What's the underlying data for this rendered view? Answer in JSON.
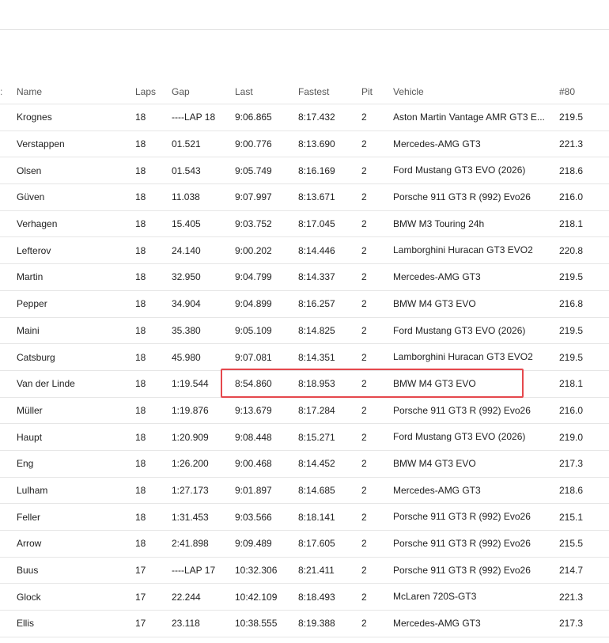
{
  "headers": {
    "edge": ":",
    "name": "Name",
    "laps": "Laps",
    "gap": "Gap",
    "last": "Last",
    "fastest": "Fastest",
    "pit": "Pit",
    "vehicle": "Vehicle",
    "top_speed": "#80"
  },
  "rows": [
    {
      "name": "Krognes",
      "laps": "18",
      "gap": "----LAP 18",
      "last": "9:06.865",
      "fastest": "8:17.432",
      "pit": "2",
      "vehicle": "Aston Martin Vantage AMR GT3 E...",
      "top_speed": "219.5"
    },
    {
      "name": "Verstappen",
      "laps": "18",
      "gap": "01.521",
      "last": "9:00.776",
      "fastest": "8:13.690",
      "pit": "2",
      "vehicle": "Mercedes-AMG GT3",
      "top_speed": "221.3"
    },
    {
      "name": "Olsen",
      "laps": "18",
      "gap": "01.543",
      "last": "9:05.749",
      "fastest": "8:16.169",
      "pit": "2",
      "vehicle": "Ford Mustang GT3 EVO (2026)",
      "top_speed": "218.6"
    },
    {
      "name": "Güven",
      "laps": "18",
      "gap": "11.038",
      "last": "9:07.997",
      "fastest": "8:13.671",
      "pit": "2",
      "vehicle": "Porsche 911 GT3 R (992) Evo26",
      "top_speed": "216.0"
    },
    {
      "name": "Verhagen",
      "laps": "18",
      "gap": "15.405",
      "last": "9:03.752",
      "fastest": "8:17.045",
      "pit": "2",
      "vehicle": "BMW M3 Touring 24h",
      "top_speed": "218.1"
    },
    {
      "name": "Lefterov",
      "laps": "18",
      "gap": "24.140",
      "last": "9:00.202",
      "fastest": "8:14.446",
      "pit": "2",
      "vehicle": "Lamborghini Huracan GT3 EVO2",
      "top_speed": "220.8"
    },
    {
      "name": "Martin",
      "laps": "18",
      "gap": "32.950",
      "last": "9:04.799",
      "fastest": "8:14.337",
      "pit": "2",
      "vehicle": "Mercedes-AMG GT3",
      "top_speed": "219.5"
    },
    {
      "name": "Pepper",
      "laps": "18",
      "gap": "34.904",
      "last": "9:04.899",
      "fastest": "8:16.257",
      "pit": "2",
      "vehicle": "BMW M4 GT3 EVO",
      "top_speed": "216.8"
    },
    {
      "name": "Maini",
      "laps": "18",
      "gap": "35.380",
      "last": "9:05.109",
      "fastest": "8:14.825",
      "pit": "2",
      "vehicle": "Ford Mustang GT3 EVO (2026)",
      "top_speed": "219.5"
    },
    {
      "name": "Catsburg",
      "laps": "18",
      "gap": "45.980",
      "last": "9:07.081",
      "fastest": "8:14.351",
      "pit": "2",
      "vehicle": "Lamborghini Huracan GT3 EVO2",
      "top_speed": "219.5"
    },
    {
      "name": "Van der Linde",
      "laps": "18",
      "gap": "1:19.544",
      "last": "8:54.860",
      "fastest": "8:18.953",
      "pit": "2",
      "vehicle": "BMW M4 GT3 EVO",
      "top_speed": "218.1"
    },
    {
      "name": "Müller",
      "laps": "18",
      "gap": "1:19.876",
      "last": "9:13.679",
      "fastest": "8:17.284",
      "pit": "2",
      "vehicle": "Porsche 911 GT3 R (992) Evo26",
      "top_speed": "216.0"
    },
    {
      "name": "Haupt",
      "laps": "18",
      "gap": "1:20.909",
      "last": "9:08.448",
      "fastest": "8:15.271",
      "pit": "2",
      "vehicle": "Ford Mustang GT3 EVO (2026)",
      "top_speed": "219.0"
    },
    {
      "name": "Eng",
      "laps": "18",
      "gap": "1:26.200",
      "last": "9:00.468",
      "fastest": "8:14.452",
      "pit": "2",
      "vehicle": "BMW M4 GT3 EVO",
      "top_speed": "217.3"
    },
    {
      "name": "Lulham",
      "laps": "18",
      "gap": "1:27.173",
      "last": "9:01.897",
      "fastest": "8:14.685",
      "pit": "2",
      "vehicle": "Mercedes-AMG GT3",
      "top_speed": "218.6"
    },
    {
      "name": "Feller",
      "laps": "18",
      "gap": "1:31.453",
      "last": "9:03.566",
      "fastest": "8:18.141",
      "pit": "2",
      "vehicle": "Porsche 911 GT3 R (992) Evo26",
      "top_speed": "215.1"
    },
    {
      "name": "Arrow",
      "laps": "18",
      "gap": "2:41.898",
      "last": "9:09.489",
      "fastest": "8:17.605",
      "pit": "2",
      "vehicle": "Porsche 911 GT3 R (992) Evo26",
      "top_speed": "215.5"
    },
    {
      "name": "Buus",
      "laps": "17",
      "gap": "----LAP 17",
      "last": "10:32.306",
      "fastest": "8:21.411",
      "pit": "2",
      "vehicle": "Porsche 911 GT3 R (992) Evo26",
      "top_speed": "214.7"
    },
    {
      "name": "Glock",
      "laps": "17",
      "gap": "22.244",
      "last": "10:42.109",
      "fastest": "8:18.493",
      "pit": "2",
      "vehicle": "McLaren 720S-GT3",
      "top_speed": "221.3"
    },
    {
      "name": "Ellis",
      "laps": "17",
      "gap": "23.118",
      "last": "10:38.555",
      "fastest": "8:19.388",
      "pit": "2",
      "vehicle": "Mercedes-AMG GT3",
      "top_speed": "217.3"
    }
  ],
  "highlight": {
    "row_index": 10,
    "color": "#e5484d"
  }
}
